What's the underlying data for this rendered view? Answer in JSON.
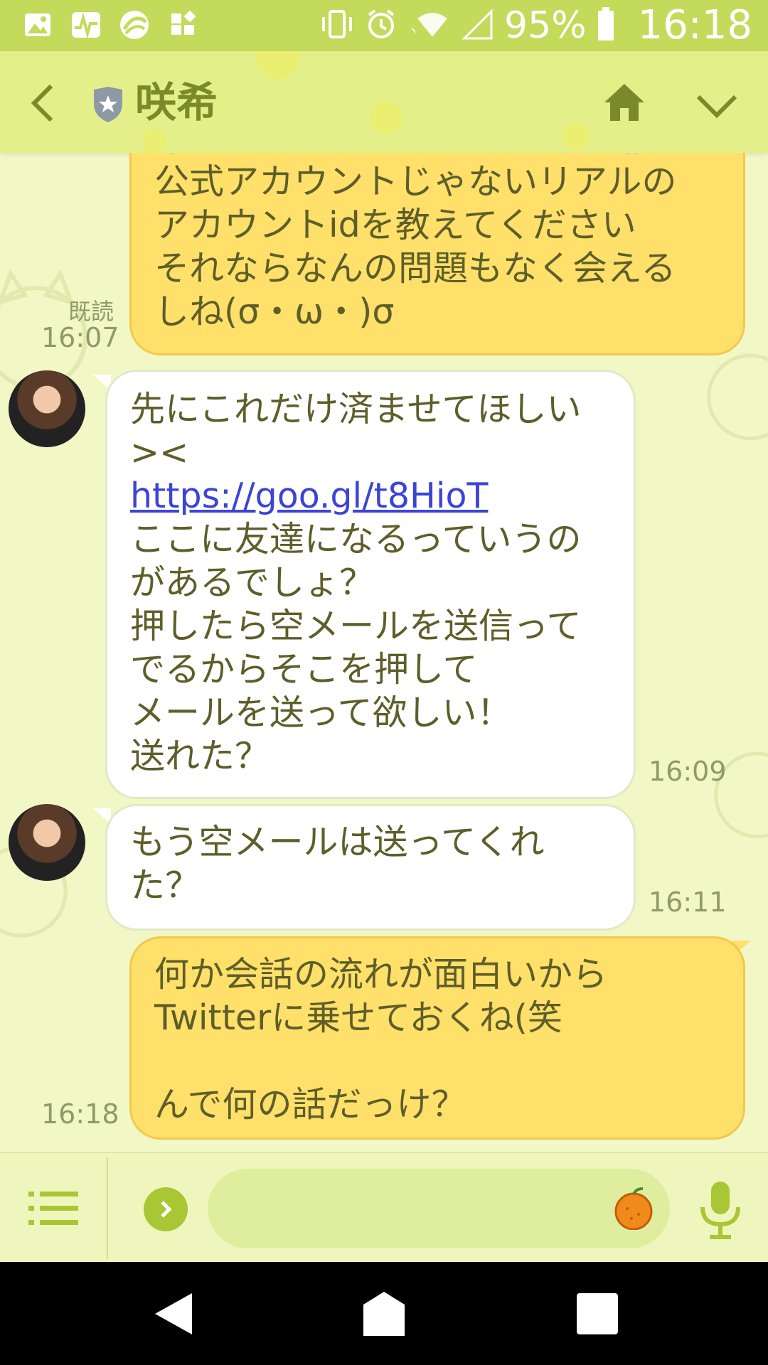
{
  "status_bar": {
    "battery": "95%",
    "time": "16:18",
    "left_icons": [
      "image-icon",
      "pulse-app-icon",
      "browser-app-icon",
      "widgets-icon"
    ],
    "right_icons": [
      "vibrate-icon",
      "alarm-icon",
      "wifi-icon",
      "signal-icon",
      "battery-icon"
    ]
  },
  "header": {
    "title": "咲希",
    "bg_color": "#e3f08a",
    "accent_color": "#7a8a2a"
  },
  "messages": [
    {
      "side": "out",
      "text": "来ないのでこちらからLINEの非\n公式アカウントじゃないリアルの\nアカウントidを教えてください\nそれならなんの問題もなく会える\nしね(σ・ω・)σ",
      "read": "既読",
      "time": "16:07"
    },
    {
      "side": "in",
      "text_before": "先にこれだけ済ませてほしい\n><",
      "link": "https://goo.gl/t8HioT",
      "text_after": "ここに友達になるっていうの\nがあるでしょ？\n押したら空メールを送信って\nでるからそこを押して\nメールを送って欲しい！\n送れた？",
      "time": "16:09"
    },
    {
      "side": "in",
      "text": "もう空メールは送ってくれ\nた？",
      "time": "16:11"
    },
    {
      "side": "out",
      "text": "何か会話の流れが面白いから\nTwitterに乗せておくね(笑\n\nんで何の話だっけ？",
      "time": "16:18"
    }
  ],
  "input": {
    "value": "",
    "placeholder": ""
  },
  "colors": {
    "out_bubble": "#ffe06a",
    "in_bubble": "#ffffff",
    "link": "#3b43d8",
    "text": "#5e5e2a"
  }
}
